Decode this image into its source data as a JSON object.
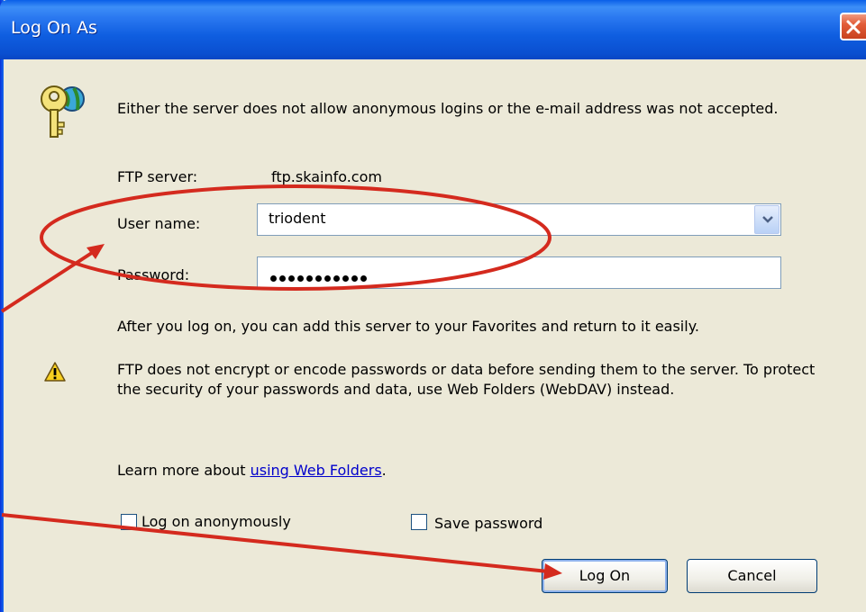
{
  "window": {
    "title": "Log On As",
    "close_icon": "close-icon"
  },
  "dialog": {
    "message": "Either the server does not allow anonymous logins or the e-mail address was not accepted.",
    "ftp_server_label": "FTP server:",
    "ftp_server_value": "ftp.skainfo.com",
    "username_label": "User name:",
    "username_value": "triodent",
    "password_label": "Password:",
    "password_mask": "•••••••••••",
    "info_text": "After you log on, you can add this server to your Favorites and return to it easily.",
    "warning_text": "FTP does not encrypt or encode passwords or data before sending them to the server.  To protect the security of your passwords and data, use Web Folders (WebDAV) instead.",
    "learn_more_prefix": "Learn more about ",
    "learn_more_link": "using Web Folders",
    "learn_more_suffix": ".",
    "anonymous_checkbox_label": "Log on anonymously",
    "save_password_label": "Save password",
    "logon_button": "Log On",
    "cancel_button": "Cancel"
  },
  "annotations": {
    "color": "#d42a1e"
  },
  "colors": {
    "titlebar": "#0a4fd0",
    "dialog_bg": "#ece9d8",
    "link": "#0000cc"
  }
}
